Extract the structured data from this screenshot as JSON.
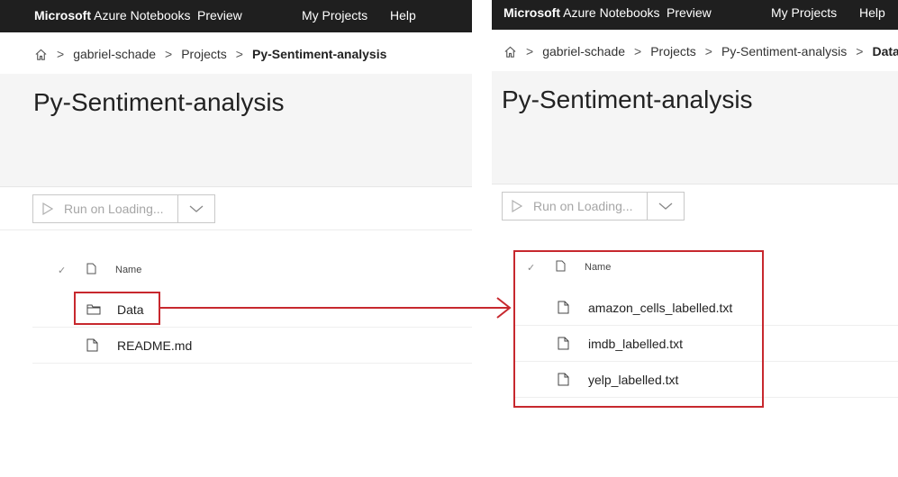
{
  "topbar": {
    "brand_bold": "Microsoft",
    "brand_rest": " Azure Notebooks",
    "preview": "Preview",
    "my_projects": "My Projects",
    "help": "Help"
  },
  "left": {
    "breadcrumb": [
      "gabriel-schade",
      "Projects",
      "Py-Sentiment-analysis"
    ],
    "title": "Py-Sentiment-analysis",
    "run_label": "Run on Loading...",
    "column_name": "Name",
    "rows": [
      {
        "name": "Data",
        "icon": "folder-icon"
      },
      {
        "name": "README.md",
        "icon": "file-icon"
      }
    ]
  },
  "right": {
    "breadcrumb": [
      "gabriel-schade",
      "Projects",
      "Py-Sentiment-analysis",
      "Data"
    ],
    "title": "Py-Sentiment-analysis",
    "run_label": "Run on Loading...",
    "column_name": "Name",
    "rows": [
      {
        "name": "amazon_cells_labelled.txt",
        "icon": "file-icon"
      },
      {
        "name": "imdb_labelled.txt",
        "icon": "file-icon"
      },
      {
        "name": "yelp_labelled.txt",
        "icon": "file-icon"
      }
    ]
  },
  "colors": {
    "highlight": "#c7282e",
    "topbar": "#1f1f1f"
  }
}
